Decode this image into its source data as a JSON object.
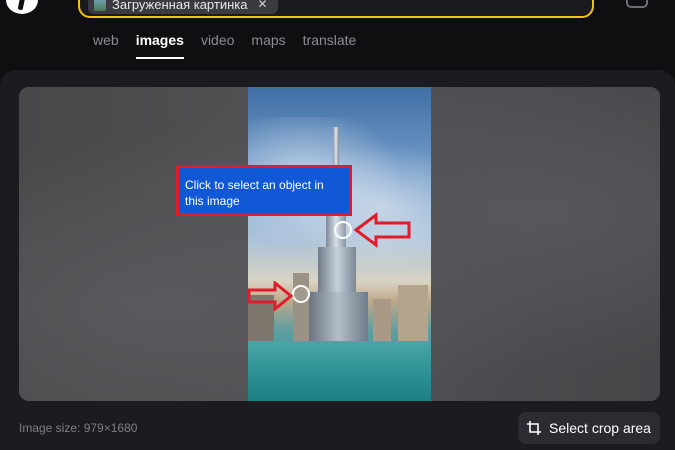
{
  "search": {
    "chip_label": "Загруженная картинка",
    "chip_close": "✕"
  },
  "tabs": [
    {
      "label": "web",
      "active": false
    },
    {
      "label": "images",
      "active": true
    },
    {
      "label": "video",
      "active": false
    },
    {
      "label": "maps",
      "active": false
    },
    {
      "label": "translate",
      "active": false
    }
  ],
  "tooltip": {
    "text": "Click to select an object in this image"
  },
  "image_info": {
    "size_label": "Image size: 979×1680"
  },
  "crop_button": {
    "label": "Select crop area",
    "icon": "crop-icon"
  },
  "colors": {
    "search_border": "#f1c40f",
    "tooltip_bg": "#1058d6",
    "highlight": "#e01b2a"
  }
}
